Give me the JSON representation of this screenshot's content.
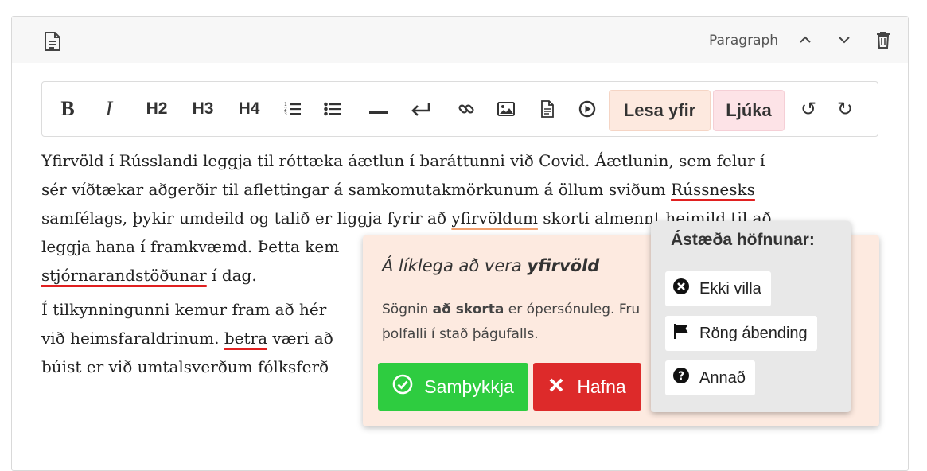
{
  "header": {
    "block_type": "Paragraph",
    "icons": [
      "document-icon",
      "chevron-up-icon",
      "chevron-down-icon",
      "trash-icon"
    ]
  },
  "toolbar": {
    "bold": "B",
    "italic": "I",
    "h2": "H2",
    "h3": "H3",
    "h4": "H4",
    "proofread_label": "Lesa yfir",
    "finish_label": "Ljúka",
    "undo": "↺",
    "redo": "↻",
    "colors": {
      "proofread_bg": "#fde9df",
      "finish_bg": "#fde3e7"
    }
  },
  "content": {
    "p1": {
      "l1": "Yfirvöld í Rússlandi leggja til róttæka áætlun í baráttunni við Covid. Áætlunin, sem felur í",
      "l2a": "sér víðtækar aðgerðir til aflettingar á samkomutakmörkunum á öllum sviðum ",
      "l2_err": "Rússnesks",
      "l3a": "samfélags, þykir umdeild og talið er liggja fyrir að ",
      "l3_warn": "yfirvöldum",
      "l3b": " skorti almennt heimild til að",
      "l4": "leggja hana í framkvæmd. Þetta kem",
      "l5_err": "stjórnarandstöðunar",
      "l5b": " í dag."
    },
    "p2": {
      "l1": "Í tilkynningunni kemur fram að hér",
      "l2a": "við heimsfaraldrinum. ",
      "l2_err": "betra",
      "l2b": " væri að",
      "l3": "búist er við umtalsverðum fólksferð"
    }
  },
  "suggestion": {
    "title_prefix": "Á líklega að vera ",
    "title_word": "yfirvöld",
    "msg_pre": "Sögnin ",
    "msg_bold": "að skorta",
    "msg_post": " er ópersónuleg. Fru",
    "msg_line2": "þolfalli í stað þágufalls.",
    "accept_label": "Samþykkja",
    "reject_label": "Hafna",
    "colors": {
      "accept": "#2ecc40",
      "reject": "#dd2a2a",
      "panel": "#fdeae0"
    }
  },
  "reasons": {
    "title": "Ástæða höfnunar:",
    "items": [
      {
        "label": "Ekki villa",
        "icon": "x-circle-icon"
      },
      {
        "label": "Röng ábending",
        "icon": "flag-icon"
      },
      {
        "label": "Annað",
        "icon": "question-circle-icon"
      }
    ]
  }
}
